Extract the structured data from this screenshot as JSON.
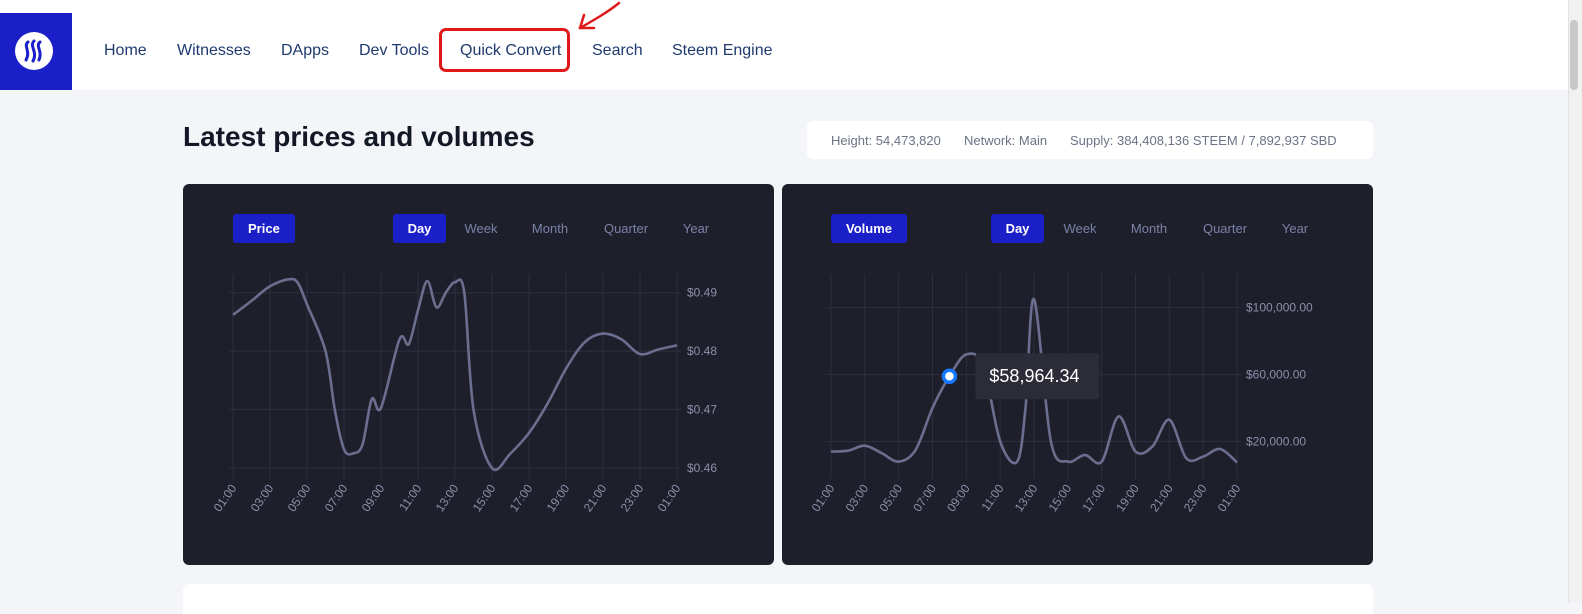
{
  "nav": {
    "items": [
      "Home",
      "Witnesses",
      "DApps",
      "Dev Tools",
      "Quick Convert",
      "Search",
      "Steem Engine"
    ]
  },
  "page": {
    "title": "Latest prices and volumes"
  },
  "stats": {
    "height": "Height: 54,473,820",
    "network": "Network: Main",
    "supply": "Supply: 384,408,136 STEEM / 7,892,937 SBD"
  },
  "ranges": [
    "Day",
    "Week",
    "Month",
    "Quarter",
    "Year"
  ],
  "colors": {
    "brand": "#1a1fc8",
    "panel": "#1f1f2b",
    "line": "#6b6e8e",
    "annotation": "#e0191b"
  },
  "chart_data": [
    {
      "type": "line",
      "tag": "Price",
      "active_range": "Day",
      "x_ticks": [
        "01:00",
        "03:00",
        "05:00",
        "07:00",
        "09:00",
        "11:00",
        "13:00",
        "15:00",
        "17:00",
        "19:00",
        "21:00",
        "23:00",
        "01:00"
      ],
      "y_ticks": [
        "$0.49",
        "$0.48",
        "$0.47",
        "$0.46"
      ],
      "y_tick_values": [
        0.49,
        0.48,
        0.47,
        0.46
      ],
      "ylim": [
        0.4588,
        0.4932
      ],
      "x": [
        0,
        1,
        2,
        3,
        3.5,
        4,
        5,
        5.5,
        6,
        6.5,
        7,
        7.5,
        8,
        9,
        9.5,
        10,
        10.5,
        11,
        11.5,
        12,
        12.5,
        13,
        14,
        15,
        16,
        17,
        18,
        19,
        20,
        21,
        22,
        23,
        24
      ],
      "values": [
        0.4862,
        0.4886,
        0.4911,
        0.4923,
        0.4917,
        0.488,
        0.48,
        0.47,
        0.4632,
        0.4625,
        0.464,
        0.4718,
        0.4703,
        0.482,
        0.4812,
        0.487,
        0.492,
        0.4875,
        0.49,
        0.4918,
        0.49,
        0.47,
        0.46,
        0.4625,
        0.466,
        0.471,
        0.477,
        0.4815,
        0.483,
        0.482,
        0.4795,
        0.4803,
        0.481
      ],
      "grid": true
    },
    {
      "type": "line",
      "tag": "Volume",
      "active_range": "Day",
      "x_ticks": [
        "01:00",
        "03:00",
        "05:00",
        "07:00",
        "09:00",
        "11:00",
        "13:00",
        "15:00",
        "17:00",
        "19:00",
        "21:00",
        "23:00",
        "01:00"
      ],
      "y_ticks": [
        "$100,000.00",
        "$60,000.00",
        "$20,000.00"
      ],
      "y_tick_values": [
        100000,
        60000,
        20000
      ],
      "ylim": [
        0,
        120000
      ],
      "x": [
        0,
        1,
        2,
        3,
        4,
        5,
        6,
        7,
        8,
        9,
        10,
        11,
        11.5,
        12,
        13,
        14,
        15,
        16,
        17,
        18,
        19,
        20,
        21,
        22,
        23,
        24
      ],
      "values": [
        14000,
        14500,
        17500,
        13000,
        8000,
        15000,
        40000,
        58964.34,
        72000,
        65000,
        20000,
        8000,
        40000,
        105000,
        20000,
        8000,
        12000,
        8000,
        35000,
        14000,
        17000,
        33000,
        10000,
        11000,
        15500,
        7500
      ],
      "tooltip": {
        "x": 7,
        "value": "$58,964.34"
      },
      "grid": true
    }
  ]
}
